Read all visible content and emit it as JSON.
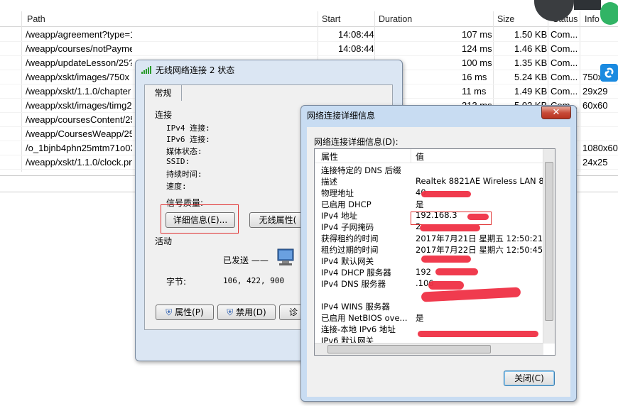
{
  "network": {
    "columns": [
      "Path",
      "Start",
      "Duration",
      "Size",
      "Status",
      "Info"
    ],
    "rows": [
      {
        "path": "/weapp/agreement?type=1",
        "start": "14:08:44",
        "duration": "107 ms",
        "size": "1.50 KB",
        "status": "Com...",
        "info": ""
      },
      {
        "path": "/weapp/courses/notPayment/25?",
        "start": "14:08:44",
        "duration": "124 ms",
        "size": "1.46 KB",
        "status": "Com...",
        "info": ""
      },
      {
        "path": "/weapp/updateLesson/25?",
        "start": "",
        "duration": "100 ms",
        "size": "1.35 KB",
        "status": "Com...",
        "info": ""
      },
      {
        "path": "/weapp/xskt/images/750x",
        "start": "",
        "duration": "16 ms",
        "size": "5.24 KB",
        "status": "Com...",
        "info": "750x"
      },
      {
        "path": "/weapp/xskt/1.1.0/chapter",
        "start": "",
        "duration": "11 ms",
        "size": "1.49 KB",
        "status": "Com...",
        "info": "29x29"
      },
      {
        "path": "/weapp/xskt/images/timg2",
        "start": "",
        "duration": "213 ms",
        "size": "5.02 KB",
        "status": "Com...",
        "info": "60x60"
      },
      {
        "path": "/weapp/coursesContent/25",
        "start": "",
        "duration": "",
        "size": "",
        "status": "",
        "info": ""
      },
      {
        "path": "/weapp/CoursesWeapp/25",
        "start": "",
        "duration": "",
        "size": "",
        "status": "",
        "info": ""
      },
      {
        "path": "/o_1bjnb4phn25mtm71o03",
        "start": "",
        "duration": "",
        "size": "",
        "status": "",
        "info": "1080x60"
      },
      {
        "path": "/weapp/xskt/1.1.0/clock.pn",
        "start": "",
        "duration": "",
        "size": "",
        "status": "",
        "info": "24x25"
      }
    ]
  },
  "status_dialog": {
    "title": "无线网络连接 2 状态",
    "tab": "常规",
    "section_connection": "连接",
    "ipv4_label": "IPv4 连接:",
    "ipv6_label": "IPv6 连接:",
    "media_label": "媒体状态:",
    "ssid_label": "SSID:",
    "duration_label": "持续时间:",
    "speed_label": "速度:",
    "signal_label": "信号质量:",
    "details_button": "详细信息(E)...",
    "wireless_button": "无线属性(",
    "section_activity": "活动",
    "sent_label": "已发送 ——",
    "bytes_label": "字节:",
    "bytes_sent": "106, 422, 900",
    "properties_button": "属性(P)",
    "disable_button": "禁用(D)",
    "diagnose_button": "诊"
  },
  "details_dialog": {
    "title": "网络连接详细信息",
    "subtitle": "网络连接详细信息(D):",
    "col_property": "属性",
    "col_value": "值",
    "close_button": "关闭(C)",
    "rows": [
      {
        "k": "连接特定的 DNS 后缀",
        "v": ""
      },
      {
        "k": "描述",
        "v": "Realtek 8821AE Wireless LAN 80"
      },
      {
        "k": "物理地址",
        "v": "40"
      },
      {
        "k": "已启用 DHCP",
        "v": "是"
      },
      {
        "k": "IPv4 地址",
        "v": "192.168.3"
      },
      {
        "k": "IPv4 子网掩码",
        "v": "2"
      },
      {
        "k": "获得租约的时间",
        "v": "2017年7月21日 星期五 12:50:21"
      },
      {
        "k": "租约过期的时间",
        "v": "2017年7月22日 星期六 12:50:45"
      },
      {
        "k": "IPv4 默认网关",
        "v": ""
      },
      {
        "k": "IPv4 DHCP 服务器",
        "v": "192"
      },
      {
        "k": "IPv4 DNS 服务器",
        "v": "            .106"
      },
      {
        "k": "",
        "v": ""
      },
      {
        "k": "IPv4 WINS 服务器",
        "v": ""
      },
      {
        "k": "已启用 NetBIOS ove...",
        "v": "是"
      },
      {
        "k": "连接-本地 IPv6 地址",
        "v": ""
      },
      {
        "k": "IPv6 默认网关",
        "v": ""
      }
    ]
  },
  "colors": {
    "close_red": "#c74a38",
    "redaction": "#ef3044",
    "highlight_box": "#e03030"
  }
}
